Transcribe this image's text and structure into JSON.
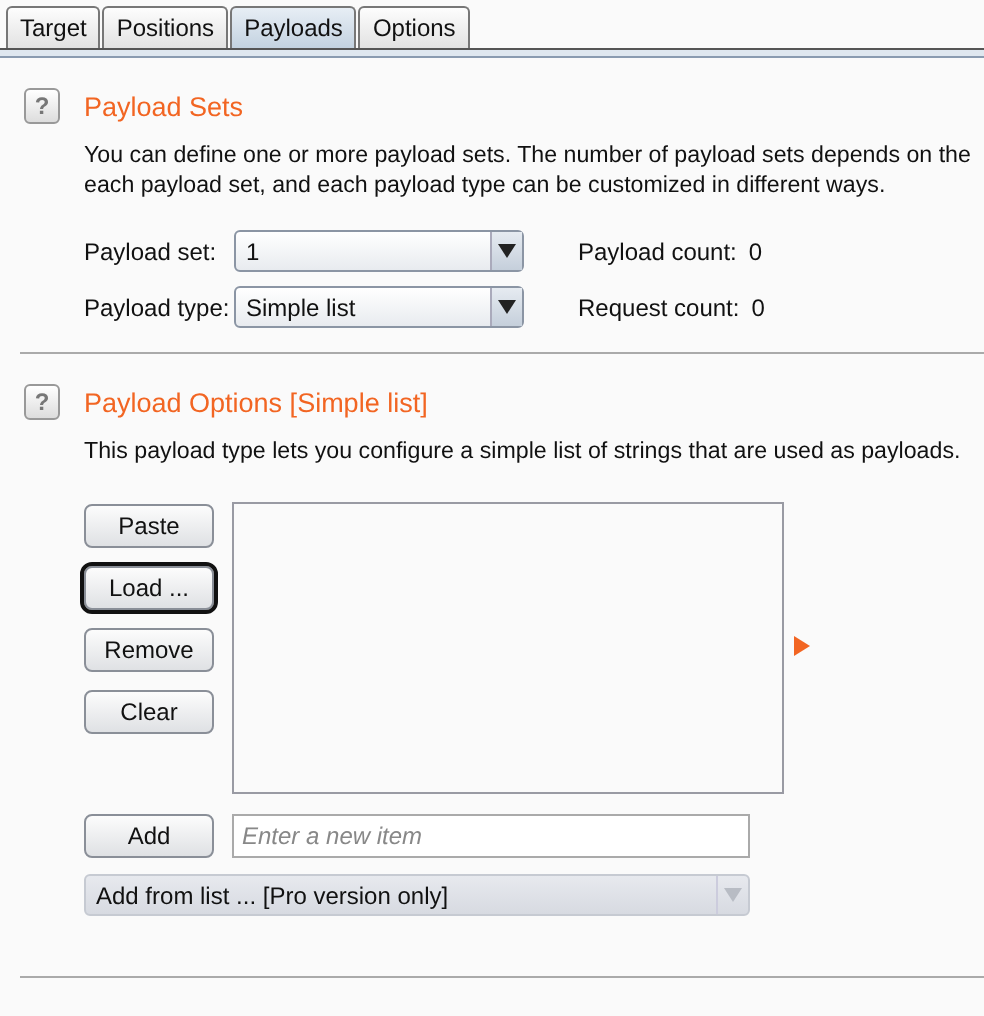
{
  "tabs": [
    {
      "label": "Target",
      "selected": false
    },
    {
      "label": "Positions",
      "selected": false
    },
    {
      "label": "Payloads",
      "selected": true
    },
    {
      "label": "Options",
      "selected": false
    }
  ],
  "payload_sets": {
    "help_icon": "?",
    "title": "Payload Sets",
    "description": [
      "You can define one or more payload sets. The number of payload sets depends on the",
      "each payload set, and each payload type can be customized in different ways."
    ],
    "fields": [
      {
        "label": "Payload set:",
        "value": "1",
        "count_label": "Payload count:",
        "count": "0"
      },
      {
        "label": "Payload type:",
        "value": "Simple list",
        "count_label": "Request count:",
        "count": "0"
      }
    ]
  },
  "payload_options": {
    "help_icon": "?",
    "title": "Payload Options [Simple list]",
    "description": "This payload type lets you configure a simple list of strings that are used as payloads.",
    "buttons": [
      {
        "label": "Paste",
        "focused": false
      },
      {
        "label": "Load ...",
        "focused": true
      },
      {
        "label": "Remove",
        "focused": false
      },
      {
        "label": "Clear",
        "focused": false
      }
    ],
    "add_button": "Add",
    "new_item": {
      "placeholder": "Enter a new item"
    },
    "add_from_list": {
      "value": "Add from list ... [Pro version only]",
      "disabled": true
    }
  }
}
